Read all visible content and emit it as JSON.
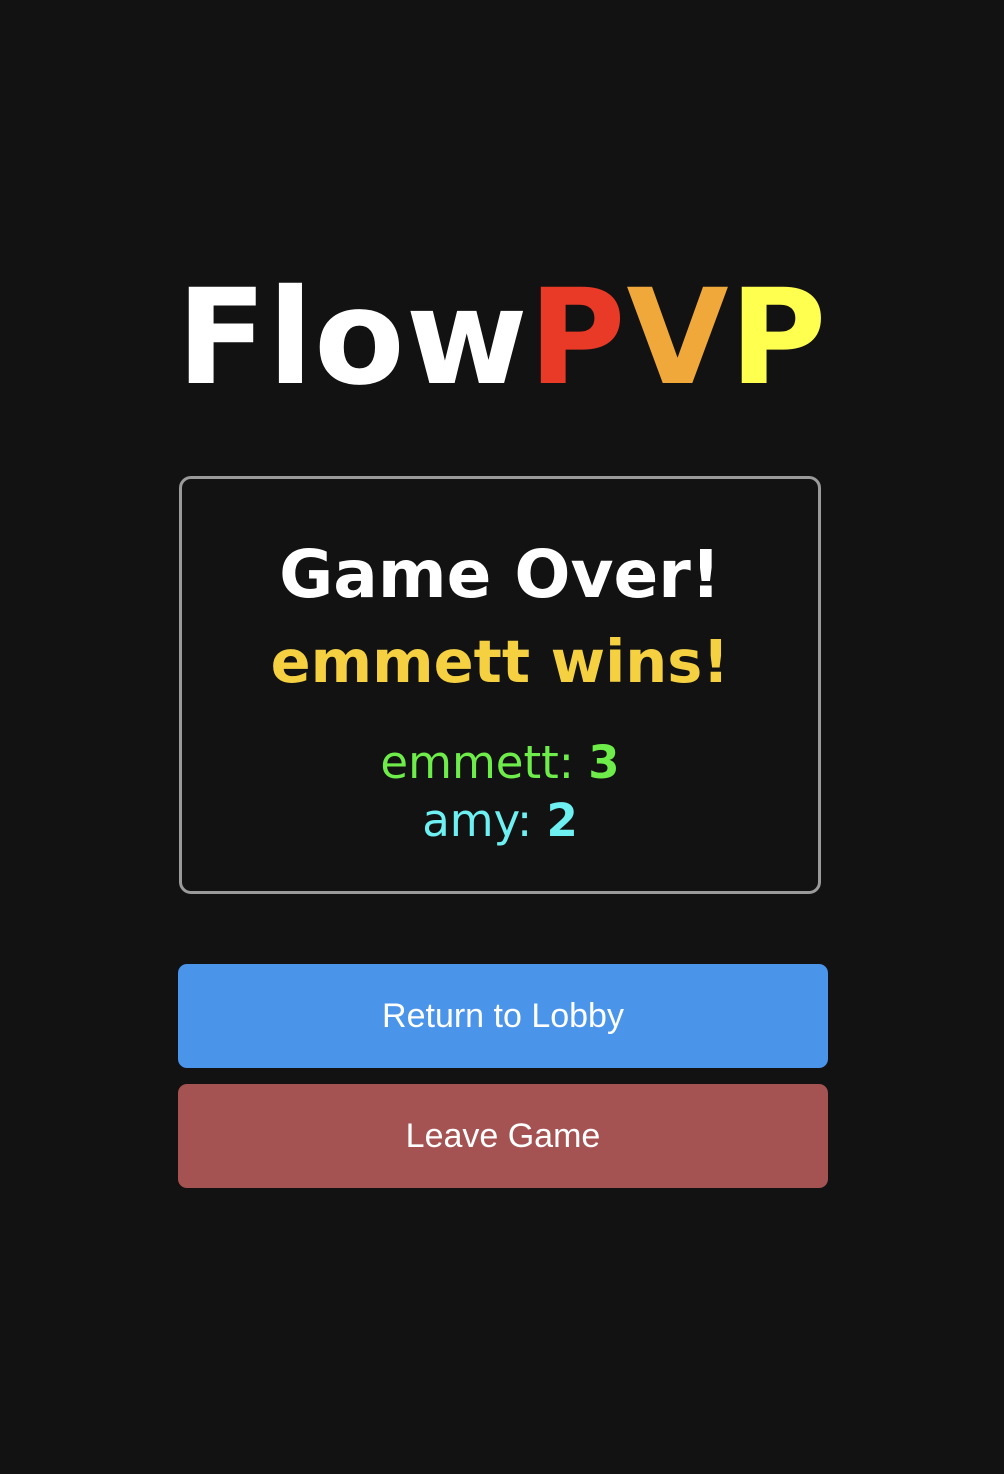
{
  "logo": {
    "part1": "Flow",
    "part2": "P",
    "part3": "V",
    "part4": "P",
    "colors": {
      "flow": "#ffffff",
      "p1": "#e83a27",
      "v": "#f0a83a",
      "p2": "#ffff4f"
    }
  },
  "result": {
    "title": "Game Over!",
    "winner_text": "emmett wins!",
    "scores": [
      {
        "name": "emmett",
        "separator": ":",
        "score": "3",
        "color": "#6eed4a"
      },
      {
        "name": "amy",
        "separator": ":",
        "score": "2",
        "color": "#6ef0f2"
      }
    ]
  },
  "actions": {
    "return_label": "Return to Lobby",
    "leave_label": "Leave Game",
    "return_color": "#4a94ea",
    "leave_color": "#a55252"
  },
  "theme": {
    "background": "#121212",
    "winner_color": "#f5d142",
    "card_border": "#9a9a9a"
  }
}
